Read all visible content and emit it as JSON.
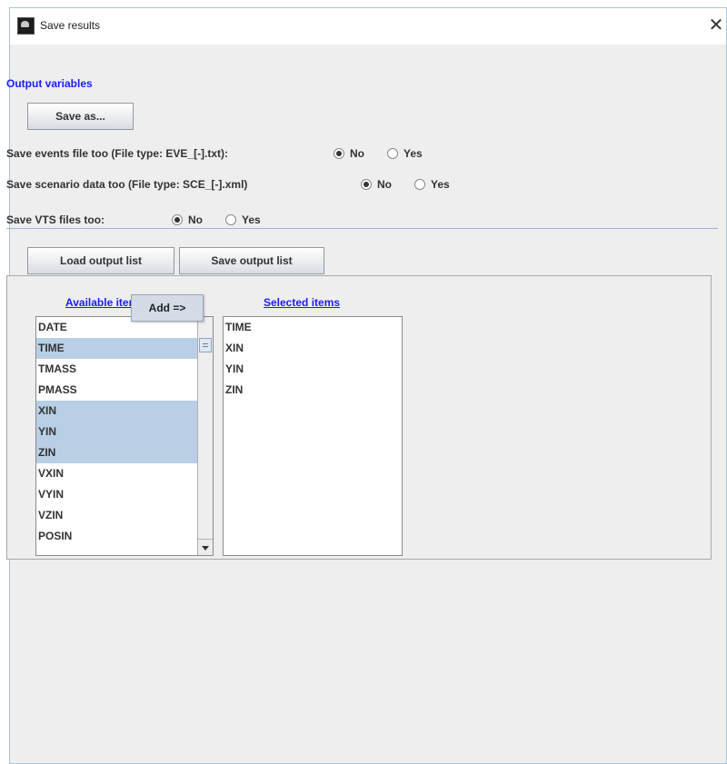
{
  "window": {
    "title": "Save results",
    "icon": "app-icon",
    "close_icon": "close-icon",
    "close_glyph": "✕"
  },
  "output": {
    "section_title": "Output variables",
    "save_as_label": "Save as..."
  },
  "options": {
    "events": {
      "label": "Save events file too (File type: EVE_[-].txt):",
      "no": "No",
      "yes": "Yes",
      "selected": "No"
    },
    "scenario": {
      "label": "Save scenario data too (File type: SCE_[-].xml)",
      "no": "No",
      "yes": "Yes",
      "selected": "No"
    },
    "vts": {
      "label": "Save VTS files too:",
      "no": "No",
      "yes": "Yes",
      "selected": "No"
    }
  },
  "buttons": {
    "load_output_list": "Load output list",
    "save_output_list": "Save output list"
  },
  "available": {
    "header": "Available items",
    "items": [
      "DATE",
      "TIME",
      "TMASS",
      "PMASS",
      "XIN",
      "YIN",
      "ZIN",
      "VXIN",
      "VYIN",
      "VZIN",
      "POSIN"
    ],
    "selected_indices": [
      1,
      4,
      5,
      6
    ]
  },
  "selected": {
    "header": "Selected items",
    "items": [
      "TIME",
      "XIN",
      "YIN",
      "ZIN"
    ]
  },
  "context_menu": {
    "add_label": "Add =>"
  },
  "colors": {
    "accent_link": "#1c1cff",
    "selection": "#b8cfe5",
    "window_bg": "#eeeeee"
  }
}
